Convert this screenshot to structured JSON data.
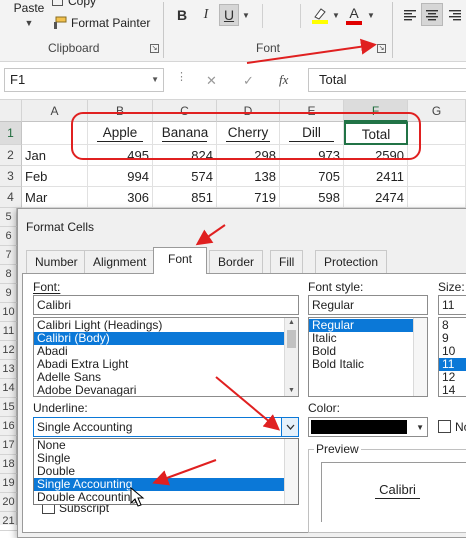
{
  "ribbon": {
    "paste_label": "Paste",
    "copy_label": "Copy",
    "format_painter_label": "Format Painter",
    "clipboard_group_label": "Clipboard",
    "font_group_label": "Font",
    "bold_label": "B",
    "italic_label": "I",
    "underline_label": "U",
    "font_color_letter": "A",
    "font_color": "#e00000",
    "highlight_color": "#ffff00",
    "launcher_icon": "dialog-launcher-icon"
  },
  "formula_bar": {
    "name_box": "F1",
    "cancel_symbol": "✕",
    "enter_symbol": "✓",
    "fx_label": "fx",
    "formula": "Total"
  },
  "grid": {
    "columns": [
      "A",
      "B",
      "C",
      "D",
      "E",
      "F",
      "G"
    ],
    "rows": [
      {
        "num": "1",
        "cells": [
          "",
          "Apple",
          "Banana",
          "Cherry",
          "Dill",
          "Total"
        ]
      },
      {
        "num": "2",
        "cells": [
          "Jan",
          "495",
          "824",
          "298",
          "973",
          "2590"
        ]
      },
      {
        "num": "3",
        "cells": [
          "Feb",
          "994",
          "574",
          "138",
          "705",
          "2411"
        ]
      },
      {
        "num": "4",
        "cells": [
          "Mar",
          "306",
          "851",
          "719",
          "598",
          "2474"
        ]
      }
    ],
    "extra_row_numbers": [
      "5",
      "6",
      "7",
      "8",
      "9",
      "10",
      "11",
      "12",
      "13",
      "14",
      "15",
      "16",
      "17",
      "18",
      "19",
      "20",
      "21"
    ]
  },
  "dialog": {
    "title": "Format Cells",
    "tabs": [
      "Number",
      "Alignment",
      "Font",
      "Border",
      "Fill",
      "Protection"
    ],
    "active_tab": "Font",
    "font": {
      "label": "Font:",
      "value": "Calibri",
      "list": [
        "Calibri Light (Headings)",
        "Calibri (Body)",
        "Abadi",
        "Abadi Extra Light",
        "Adelle Sans",
        "Adobe Devanagari"
      ],
      "selected": "Calibri (Body)"
    },
    "font_style": {
      "label": "Font style:",
      "value": "Regular",
      "list": [
        "Regular",
        "Italic",
        "Bold",
        "Bold Italic"
      ],
      "selected": "Regular"
    },
    "size": {
      "label": "Size:",
      "value": "11",
      "list": [
        "8",
        "9",
        "10",
        "11",
        "12",
        "14"
      ],
      "selected": "11"
    },
    "underline": {
      "label": "Underline:",
      "value": "Single Accounting",
      "options": [
        "None",
        "Single",
        "Double",
        "Single Accounting",
        "Double Accounting"
      ],
      "selected": "Single Accounting"
    },
    "color": {
      "label": "Color:",
      "value": "#000000"
    },
    "normal_font_label": "No",
    "subscript_label": "Subscript",
    "preview": {
      "label": "Preview",
      "sample": "Calibri"
    }
  },
  "annotation_color": "#e02020"
}
